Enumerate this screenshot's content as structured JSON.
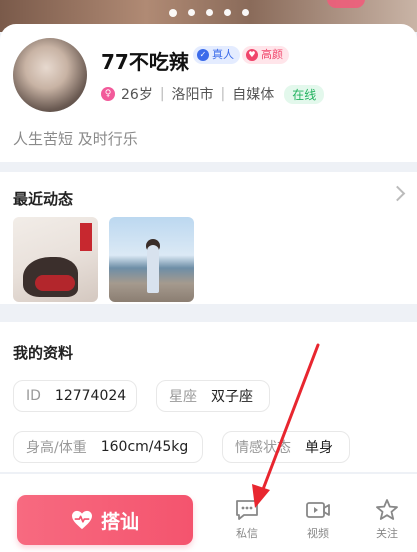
{
  "hero": {
    "dot_count": 5
  },
  "profile": {
    "name": "77不吃辣",
    "badges": {
      "real": "真人",
      "pretty": "高颜"
    },
    "age": "26岁",
    "city": "洛阳市",
    "job": "自媒体",
    "status": "在线",
    "bio": "人生苦短 及时行乐"
  },
  "recent": {
    "title": "最近动态"
  },
  "info": {
    "title": "我的资料",
    "fields": [
      {
        "key": "ID",
        "value": "12774024"
      },
      {
        "key": "星座",
        "value": "双子座"
      },
      {
        "key": "身高/体重",
        "value": "160cm/45kg"
      },
      {
        "key": "情感状态",
        "value": "单身"
      }
    ]
  },
  "bottom": {
    "cta_label": "搭讪",
    "message": "私信",
    "video": "视频",
    "follow": "关注"
  },
  "colors": {
    "accent": "#f4546e",
    "online": "#22b25e",
    "verified": "#3b6bea",
    "annotation": "#e8262f"
  }
}
